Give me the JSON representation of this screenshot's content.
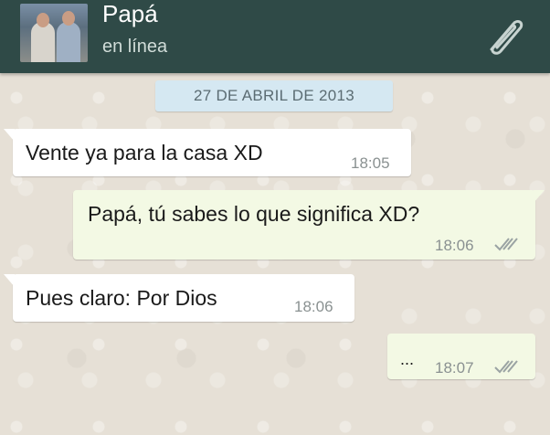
{
  "header": {
    "contact_name": "Papá",
    "contact_status": "en línea",
    "attach_icon": "paperclip-icon",
    "background_color": "#2f4a47"
  },
  "chat": {
    "date_badge": "27 DE ABRIL DE 2013",
    "messages": [
      {
        "direction": "incoming",
        "text": "Vente ya para la casa XD",
        "time": "18:05",
        "read_ticks": false
      },
      {
        "direction": "outgoing",
        "text": "Papá, tú sabes lo que significa XD?",
        "time": "18:06",
        "read_ticks": true
      },
      {
        "direction": "incoming",
        "text": "Pues claro: Por Dios",
        "time": "18:06",
        "read_ticks": false
      },
      {
        "direction": "outgoing",
        "text": "...",
        "time": "18:07",
        "read_ticks": true
      }
    ],
    "incoming_bubble_color": "#ffffff",
    "outgoing_bubble_color": "#f3f9e4",
    "date_badge_color": "#d5e8f2"
  }
}
